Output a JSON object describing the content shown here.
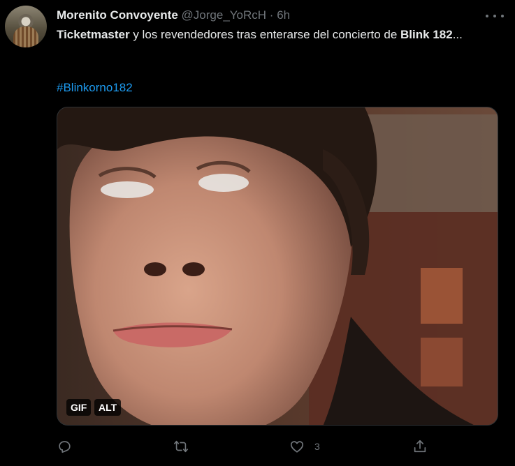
{
  "tweet": {
    "author": {
      "display_name": "Morenito Convoyente",
      "handle": "@Jorge_YoRcH",
      "separator": "·",
      "time": "6h"
    },
    "text": {
      "segment_1_bold": "Ticketmaster",
      "segment_2": " y los revendedores tras enterarse del concierto de ",
      "segment_3_bold": "Blink 182",
      "segment_4": "..."
    },
    "hashtag": "#Blinkorno182",
    "media": {
      "badges": {
        "gif": "GIF",
        "alt": "ALT"
      }
    },
    "actions": {
      "reply_icon": "reply-icon",
      "retweet_icon": "retweet-icon",
      "like_icon": "heart-icon",
      "like_count": "3",
      "share_icon": "share-icon"
    }
  },
  "colors": {
    "background": "#000000",
    "text_primary": "#e7e9ea",
    "text_secondary": "#71767b",
    "link": "#1d9bf0"
  }
}
